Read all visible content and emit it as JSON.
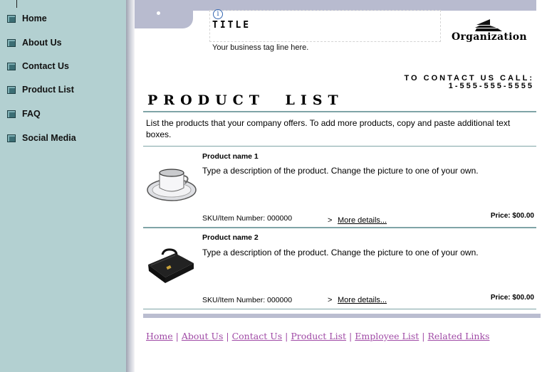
{
  "sidebar": {
    "items": [
      {
        "label": "Home"
      },
      {
        "label": "About Us"
      },
      {
        "label": "Contact Us"
      },
      {
        "label": "Product List"
      },
      {
        "label": "FAQ"
      },
      {
        "label": "Social Media"
      }
    ]
  },
  "header": {
    "title": "TITLE",
    "tagline": "Your business tag line here.",
    "organization": "Organization",
    "contact_label": "TO CONTACT US CALL:",
    "contact_phone": "1-555-555-5555"
  },
  "main": {
    "heading": "PRODUCT LIST",
    "intro": "List the products that your company offers. To add more products, copy and paste additional text boxes.",
    "products": [
      {
        "name": "Product name 1",
        "description": "Type a description of the product. Change the picture to one of your own.",
        "sku": "SKU/Item Number: 000000",
        "more_arrow": ">",
        "more_label": "More details...",
        "price": "Price: $00.00"
      },
      {
        "name": "Product name 2",
        "description": "Type a description of the product. Change the picture to one of your own.",
        "sku": "SKU/Item Number: 000000",
        "more_arrow": ">",
        "more_label": "More details...",
        "price": "Price: $00.00"
      }
    ]
  },
  "footer": {
    "links": [
      {
        "label": "Home"
      },
      {
        "label": "About Us"
      },
      {
        "label": "Contact Us"
      },
      {
        "label": "Product List"
      },
      {
        "label": "Employee List"
      },
      {
        "label": "Related Links"
      }
    ],
    "separator": " | "
  },
  "icons": {
    "info": "info-icon",
    "logo": "organization-logo-icon",
    "nav_bullet": "square-bullet-icon"
  },
  "colors": {
    "sidebar_bg": "#b3d0d1",
    "header_band": "#b8bbcf",
    "rule": "#7fa4a7",
    "footer_link": "#a04aa6"
  }
}
